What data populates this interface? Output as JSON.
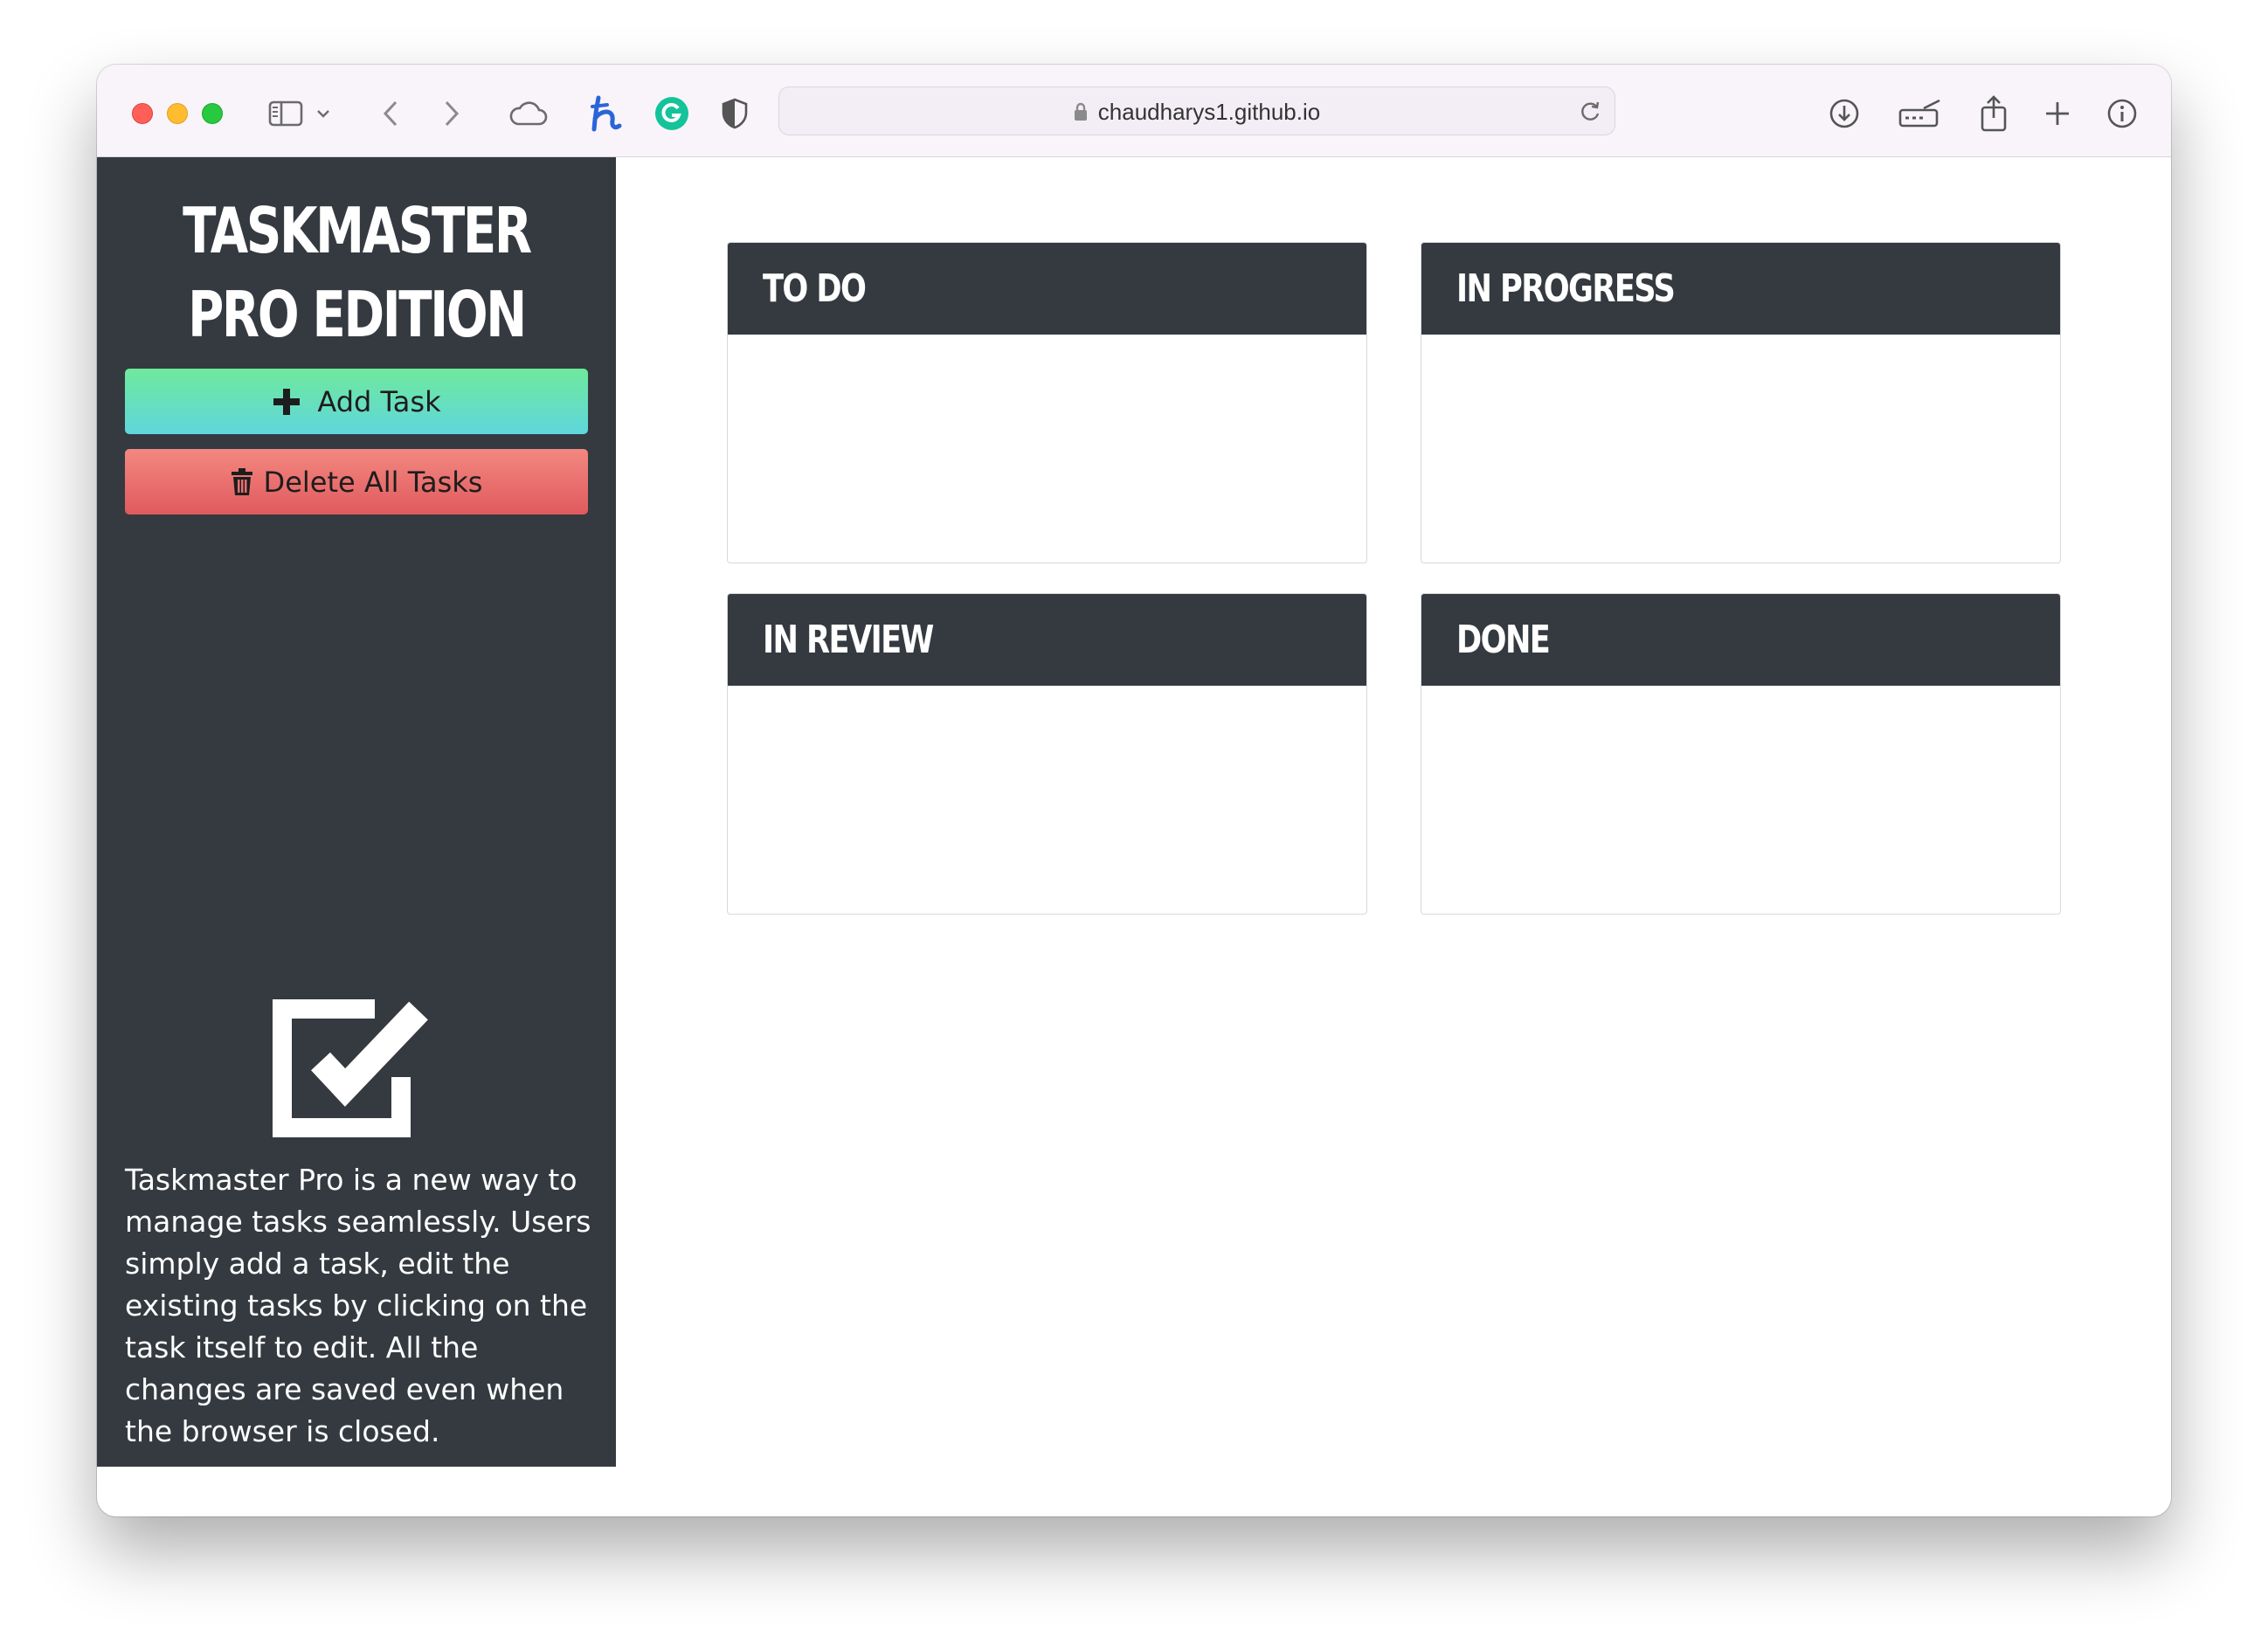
{
  "browser": {
    "url": "chaudharys1.github.io"
  },
  "app": {
    "title": "Taskmaster Pro Edition",
    "add_label": "Add Task",
    "delete_label": "Delete All Tasks",
    "description": "Taskmaster Pro is a new way to manage tasks seamlessly. Users simply add a task, edit the existing tasks by clicking on the task itself to edit. All the changes are saved even when the browser is closed."
  },
  "lanes": [
    {
      "title": "To Do"
    },
    {
      "title": "In Progress"
    },
    {
      "title": "In Review"
    },
    {
      "title": "Done"
    }
  ],
  "colors": {
    "sidebar": "#343a40",
    "add_gradient": [
      "#6fe99c",
      "#5fd6dc"
    ],
    "delete_gradient": [
      "#f38880",
      "#e05a5e"
    ]
  },
  "icons": {
    "add": "plus-icon",
    "delete": "trash-icon",
    "logo": "checkbox-checked-icon"
  }
}
